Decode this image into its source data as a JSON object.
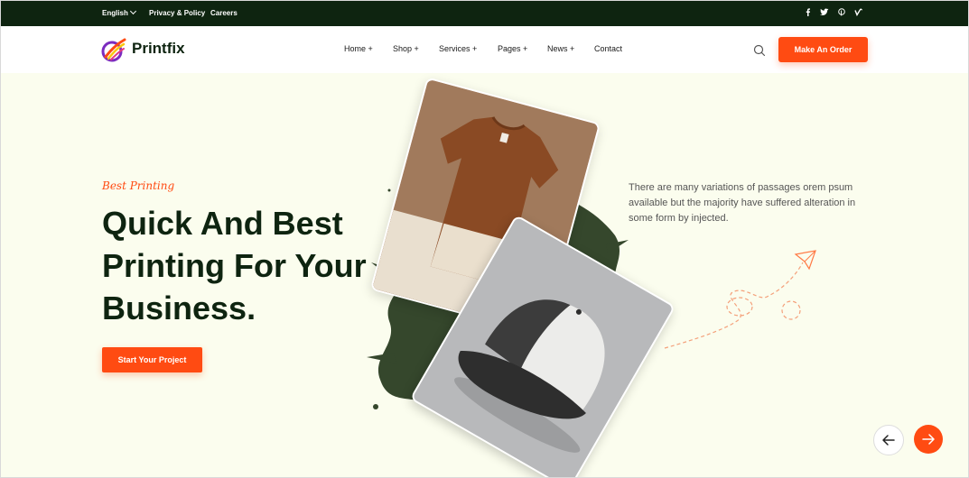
{
  "topbar": {
    "language": "English",
    "links": [
      "Privacy & Policy",
      "Careers"
    ],
    "social": [
      {
        "icon": "facebook-icon",
        "glyph": "f"
      },
      {
        "icon": "twitter-icon",
        "glyph": "t"
      },
      {
        "icon": "pinterest-icon",
        "glyph": "p"
      },
      {
        "icon": "vimeo-icon",
        "glyph": "v"
      }
    ]
  },
  "header": {
    "brand": "Printfix",
    "nav": [
      "Home +",
      "Shop +",
      "Services +",
      "Pages +",
      "News +",
      "Contact"
    ],
    "order_label": "Make An Order"
  },
  "hero": {
    "eyebrow": "Best Printing",
    "headline": [
      "Quick And Best",
      "Printing For Your",
      "Business."
    ],
    "cta_label": "Start Your Project",
    "description": "There are many variations of passages orem psum available but the majority have suffered alteration in some form by injected."
  },
  "colors": {
    "accent": "#ff4b12",
    "dark_green": "#0e2410",
    "hero_bg": "#fbfdee"
  }
}
